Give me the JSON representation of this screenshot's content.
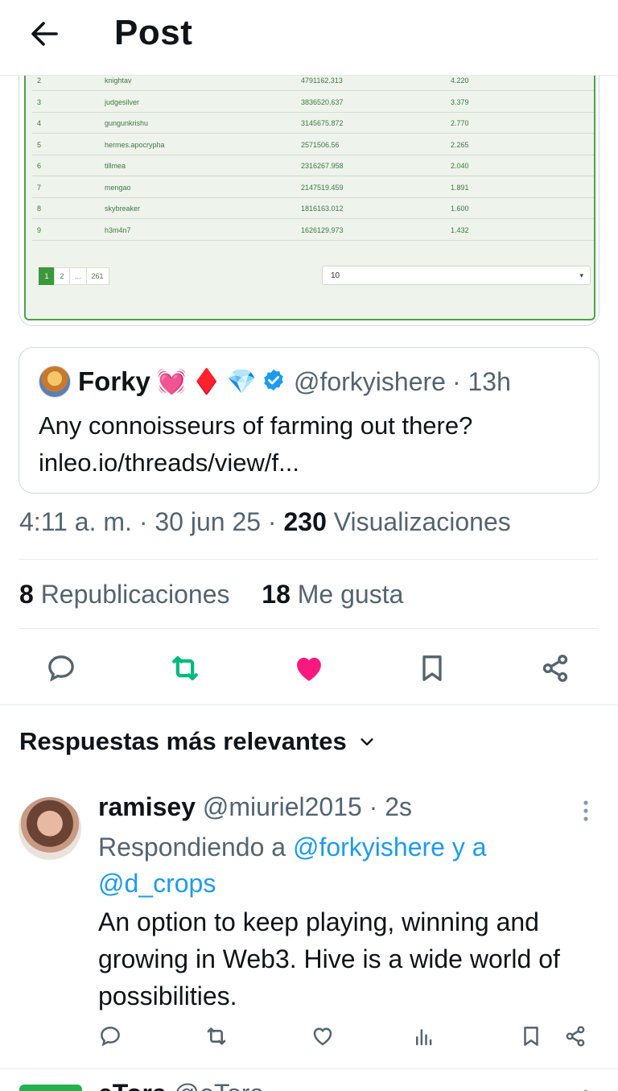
{
  "header": {
    "title": "Post"
  },
  "leaderboard": {
    "rows": [
      {
        "rank": "2",
        "name": "knightav",
        "score": "4791162.313",
        "pct": "4.220"
      },
      {
        "rank": "3",
        "name": "judgesilver",
        "score": "3836520.637",
        "pct": "3.379"
      },
      {
        "rank": "4",
        "name": "gungunkrishu",
        "score": "3145675.872",
        "pct": "2.770"
      },
      {
        "rank": "5",
        "name": "hermes.apocrypha",
        "score": "2571506.56",
        "pct": "2.265"
      },
      {
        "rank": "6",
        "name": "tillmea",
        "score": "2316267.958",
        "pct": "2.040"
      },
      {
        "rank": "7",
        "name": "mengao",
        "score": "2147519.459",
        "pct": "1.891"
      },
      {
        "rank": "8",
        "name": "skybreaker",
        "score": "1816163.012",
        "pct": "1.600"
      },
      {
        "rank": "9",
        "name": "h3m4n7",
        "score": "1626129.973",
        "pct": "1.432"
      }
    ],
    "pages": [
      "1",
      "2",
      "...",
      "261"
    ],
    "per_page": "10"
  },
  "quote": {
    "name": "Forky",
    "emojis": [
      "💓",
      "♦️",
      "💎"
    ],
    "handle": "@forkyishere",
    "time": "· 13h",
    "text": "Any connoisseurs of farming out there? inleo.io/threads/view/f..."
  },
  "meta": {
    "time": "4:11 a. m. · 30 jun 25 ·",
    "views_count": "230",
    "views_label": "Visualizaciones"
  },
  "stats": {
    "reposts_count": "8",
    "reposts_label": "Republicaciones",
    "likes_count": "18",
    "likes_label": "Me gusta"
  },
  "replies_title": "Respuestas más relevantes",
  "reply": {
    "name": "ramisey",
    "handle": "@miuriel2015 · 2s",
    "replying_prefix": "Respondiendo a",
    "replying_to": "@forkyishere y a @d_crops",
    "text": "An option to keep playing, winning and growing in Web3. Hive is a wide world of possibilities."
  },
  "next_reply": {
    "name": "eTora",
    "handle": "@eTora"
  },
  "colors": {
    "accent_blue": "#1d9bf0",
    "repost_green": "#00ba7c",
    "like_pink": "#f91880",
    "text_gray": "#536471"
  }
}
